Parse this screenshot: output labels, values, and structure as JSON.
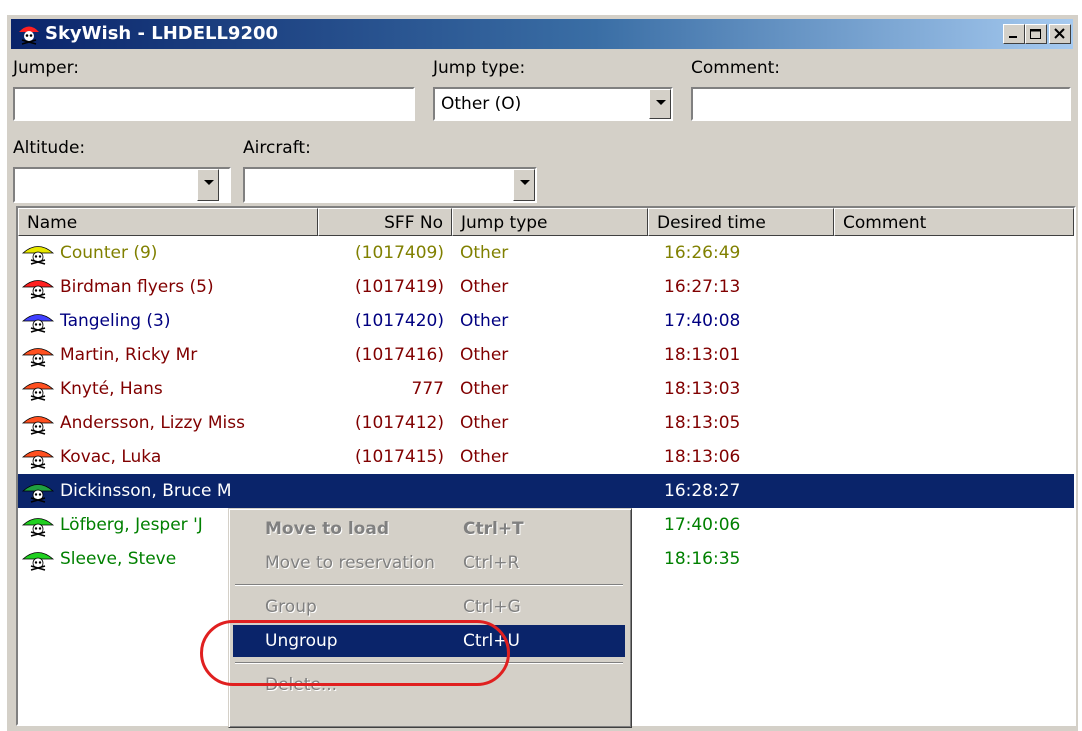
{
  "window": {
    "title": "SkyWish - LHDELL9200",
    "controls": [
      "minimize",
      "maximize",
      "close"
    ]
  },
  "form": {
    "jumper_label": "Jumper:",
    "jumper_value": "",
    "jump_type_label": "Jump type:",
    "jump_type_value": "Other  (O)",
    "comment_label": "Comment:",
    "comment_value": "",
    "altitude_label": "Altitude:",
    "altitude_value": "",
    "aircraft_label": "Aircraft:",
    "aircraft_value": ""
  },
  "list": {
    "columns": [
      "Name",
      "SFF No",
      "Jump type",
      "Desired time",
      "Comment"
    ],
    "rows": [
      {
        "name": "Counter (9)",
        "sff": "(1017409)",
        "type": "Other",
        "time": "16:26:49",
        "comment": "",
        "color": "#808000",
        "icon_color": "#e8e800"
      },
      {
        "name": "Birdman flyers (5)",
        "sff": "(1017419)",
        "type": "Other",
        "time": "16:27:13",
        "comment": "",
        "color": "#800000",
        "icon_color": "#ff2020"
      },
      {
        "name": "Tangeling (3)",
        "sff": "(1017420)",
        "type": "Other",
        "time": "17:40:08",
        "comment": "",
        "color": "#000080",
        "icon_color": "#4040ff"
      },
      {
        "name": "Martin, Ricky Mr",
        "sff": "(1017416)",
        "type": "Other",
        "time": "18:13:01",
        "comment": "",
        "color": "#800000",
        "icon_color": "#ff5020"
      },
      {
        "name": "Knyté, Hans",
        "sff": "777",
        "type": "Other",
        "time": "18:13:03",
        "comment": "",
        "color": "#800000",
        "icon_color": "#ff5020"
      },
      {
        "name": "Andersson, Lizzy Miss",
        "sff": "(1017412)",
        "type": "Other",
        "time": "18:13:05",
        "comment": "",
        "color": "#800000",
        "icon_color": "#ff5020"
      },
      {
        "name": "Kovac, Luka",
        "sff": "(1017415)",
        "type": "Other",
        "time": "18:13:06",
        "comment": "",
        "color": "#800000",
        "icon_color": "#ff5020"
      },
      {
        "name": "Dickinsson, Bruce M",
        "sff": "",
        "type": "",
        "time": "16:28:27",
        "comment": "",
        "color": "#ffffff",
        "icon_color": "#20a040",
        "selected": true
      },
      {
        "name": "Löfberg, Jesper 'J",
        "sff": "",
        "type": "",
        "time": "17:40:06",
        "comment": "",
        "color": "#008000",
        "icon_color": "#20d020"
      },
      {
        "name": "Sleeve, Steve",
        "sff": "",
        "type": "",
        "time": "18:16:35",
        "comment": "",
        "color": "#008000",
        "icon_color": "#20d020"
      }
    ]
  },
  "context_menu": {
    "items": [
      {
        "label": "Move to load",
        "shortcut": "Ctrl+T",
        "disabled": true,
        "bold": true
      },
      {
        "label": "Move to reservation",
        "shortcut": "Ctrl+R",
        "disabled": true
      },
      {
        "separator": true
      },
      {
        "label": "Group",
        "shortcut": "Ctrl+G",
        "disabled": true
      },
      {
        "label": "Ungroup",
        "shortcut": "Ctrl+U",
        "highlighted": true
      },
      {
        "separator": true
      },
      {
        "label": "Delete...",
        "shortcut": "",
        "disabled": true
      }
    ]
  },
  "colors": {
    "title_start": "#0a246a",
    "title_end": "#a6caf0",
    "selection": "#0a246a",
    "annotation": "#e02020"
  },
  "icons": {
    "app": "parachute-skull-icon",
    "row": "parachute-skull-icon",
    "dropdown": "chevron-down-icon"
  }
}
